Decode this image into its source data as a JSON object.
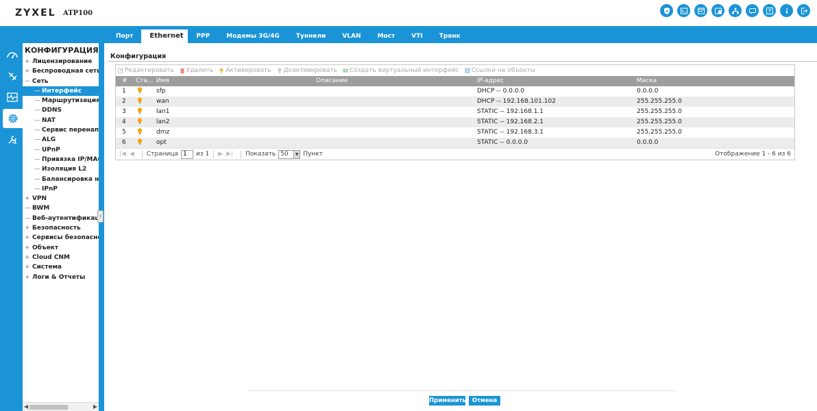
{
  "header": {
    "logo": "ZYXEL",
    "model": "ATP100"
  },
  "top_icons": [
    "shield-icon",
    "terminal-icon",
    "console-icon",
    "window-icon",
    "network-icon",
    "chat-icon",
    "help-icon",
    "info-icon",
    "logout-icon"
  ],
  "tabs": [
    {
      "label": "Порт",
      "active": false
    },
    {
      "label": "Ethernet",
      "active": true
    },
    {
      "label": "PPP",
      "active": false
    },
    {
      "label": "Модемы 3G/4G",
      "active": false
    },
    {
      "label": "Туннели",
      "active": false
    },
    {
      "label": "VLAN",
      "active": false
    },
    {
      "label": "Мост",
      "active": false
    },
    {
      "label": "VTI",
      "active": false
    },
    {
      "label": "Транк",
      "active": false
    }
  ],
  "sidebar": {
    "title": "КОНФИГУРАЦИЯ",
    "items": [
      {
        "label": "Лицензирование",
        "sym": "+",
        "level": 0
      },
      {
        "label": "Беспроводная сеть",
        "sym": "+",
        "level": 0
      },
      {
        "label": "Сеть",
        "sym": "−",
        "level": 0
      },
      {
        "label": "Интерфейс",
        "sym": "—",
        "level": 1,
        "active": true
      },
      {
        "label": "Маршрутизация",
        "sym": "—",
        "level": 1
      },
      {
        "label": "DDNS",
        "sym": "—",
        "level": 1
      },
      {
        "label": "NAT",
        "sym": "—",
        "level": 1
      },
      {
        "label": "Сервис перенапра",
        "sym": "—",
        "level": 1
      },
      {
        "label": "ALG",
        "sym": "—",
        "level": 1
      },
      {
        "label": "UPnP",
        "sym": "—",
        "level": 1
      },
      {
        "label": "Привязка IP/MAC",
        "sym": "—",
        "level": 1
      },
      {
        "label": "Изоляция L2",
        "sym": "—",
        "level": 1
      },
      {
        "label": "Балансировка наг",
        "sym": "—",
        "level": 1
      },
      {
        "label": "IPnP",
        "sym": "—",
        "level": 1
      },
      {
        "label": "VPN",
        "sym": "+",
        "level": 0
      },
      {
        "label": "BWM",
        "sym": "—",
        "level": 0
      },
      {
        "label": "Веб-аутентификация",
        "sym": "—",
        "level": 0
      },
      {
        "label": "Безопасность",
        "sym": "+",
        "level": 0
      },
      {
        "label": "Сервисы безопасност",
        "sym": "+",
        "level": 0
      },
      {
        "label": "Объект",
        "sym": "+",
        "level": 0
      },
      {
        "label": "Cloud CNM",
        "sym": "+",
        "level": 0
      },
      {
        "label": "Система",
        "sym": "+",
        "level": 0
      },
      {
        "label": "Логи & Отчеты",
        "sym": "+",
        "level": 0
      }
    ]
  },
  "main": {
    "section_title": "Конфигурация",
    "toolbar": {
      "edit": "Редактировать",
      "delete": "Удалить",
      "activate": "Активировать",
      "deactivate": "Деактивировать",
      "create_virtual": "Создать виртуальный интерфейс",
      "object_refs": "Ссылки на объекты"
    },
    "table": {
      "headers": {
        "no": "#",
        "status": "Ста...",
        "name": "Имя",
        "description": "Описание",
        "ip": "IP-адрес",
        "mask": "Маска"
      },
      "rows": [
        {
          "no": "1",
          "name": "sfp",
          "description": "",
          "ip": "DHCP -- 0.0.0.0",
          "mask": "0.0.0.0"
        },
        {
          "no": "2",
          "name": "wan",
          "description": "",
          "ip": "DHCP -- 192.168.101.102",
          "mask": "255.255.255.0"
        },
        {
          "no": "3",
          "name": "lan1",
          "description": "",
          "ip": "STATIC -- 192.168.1.1",
          "mask": "255.255.255.0"
        },
        {
          "no": "4",
          "name": "lan2",
          "description": "",
          "ip": "STATIC -- 192.168.2.1",
          "mask": "255.255.255.0"
        },
        {
          "no": "5",
          "name": "dmz",
          "description": "",
          "ip": "STATIC -- 192.168.3.1",
          "mask": "255.255.255.0"
        },
        {
          "no": "6",
          "name": "opt",
          "description": "",
          "ip": "STATIC -- 0.0.0.0",
          "mask": "0.0.0.0"
        }
      ]
    },
    "pager": {
      "page_label": "Страница",
      "page_value": "1",
      "of_label": "из 1",
      "show_label": "Показать",
      "per_page": "50",
      "unit_label": "Пункт",
      "display_text": "Отображение 1 - 6 из 6"
    }
  },
  "buttons": {
    "apply": "Применить",
    "cancel": "Отмена"
  },
  "colors": {
    "accent": "#1a94d6",
    "header_row": "#9e9e9e",
    "bulb": "#f5a800"
  }
}
